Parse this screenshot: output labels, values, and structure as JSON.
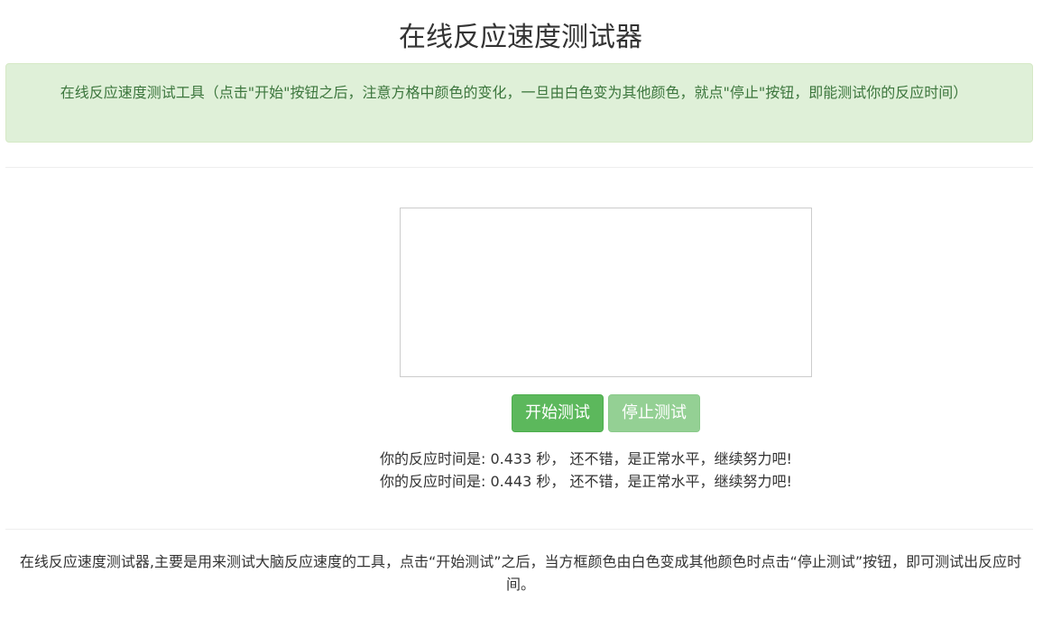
{
  "page": {
    "title": "在线反应速度测试器"
  },
  "alert": {
    "text": "在线反应速度测试工具（点击\"开始\"按钮之后，注意方格中颜色的变化，一旦由白色变为其他颜色，就点\"停止\"按钮，即能测试你的反应时间）"
  },
  "buttons": {
    "start_label": "开始测试",
    "stop_label": "停止测试"
  },
  "results": [
    "你的反应时间是: 0.433 秒，  还不错，是正常水平，继续努力吧!",
    "你的反应时间是: 0.443 秒，  还不错，是正常水平，继续努力吧!"
  ],
  "footer": {
    "description": "在线反应速度测试器,主要是用来测试大脑反应速度的工具，点击“开始测试”之后，当方框颜色由白色变成其他颜色时点击“停止测试”按钮，即可测试出反应时间。"
  },
  "colors": {
    "alert_bg": "#dff0d8",
    "alert_text": "#3c763d",
    "button_green": "#5cb85c",
    "box_color": "#ffffff"
  }
}
